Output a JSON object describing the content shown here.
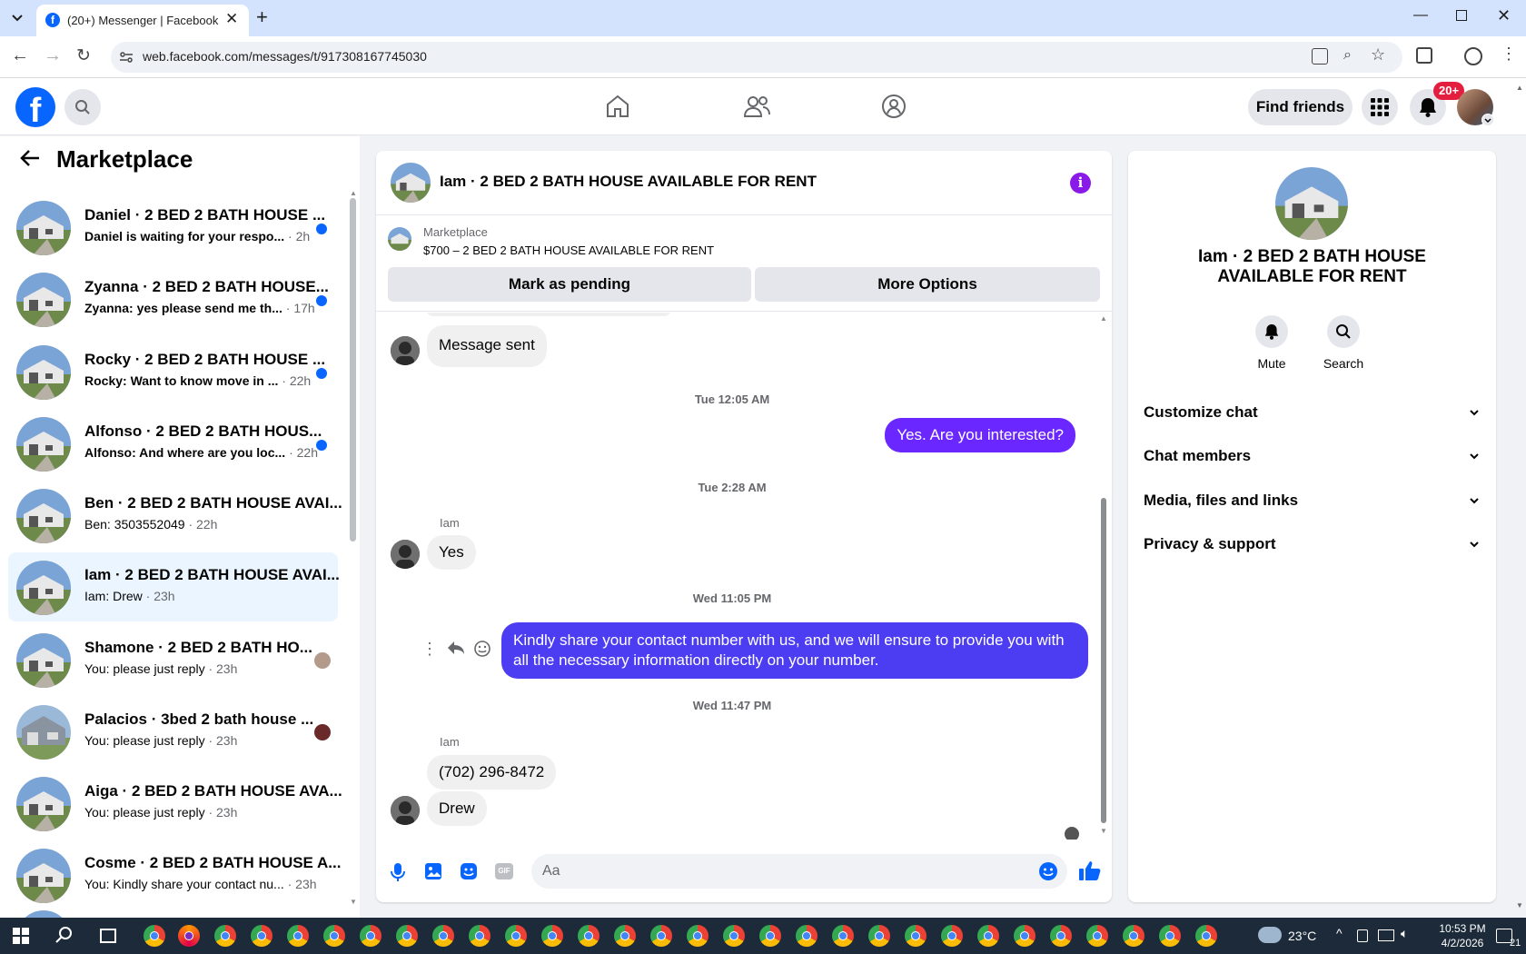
{
  "browser": {
    "tab_title": "(20+) Messenger | Facebook",
    "url": "web.facebook.com/messages/t/917308167745030"
  },
  "header": {
    "find_friends": "Find friends",
    "notif_badge": "20+"
  },
  "sidebar": {
    "title": "Marketplace",
    "conversations": [
      {
        "title": "Daniel · 2 BED 2 BATH HOUSE ...",
        "preview": "Daniel is waiting for your respo...",
        "time": "· 2h",
        "unread": true
      },
      {
        "title": "Zyanna · 2 BED 2 BATH HOUSE...",
        "preview": "Zyanna: yes please send me th...",
        "time": "· 17h",
        "unread": true
      },
      {
        "title": "Rocky · 2 BED 2 BATH HOUSE ...",
        "preview": "Rocky: Want to know move in ...",
        "time": "· 22h",
        "unread": true
      },
      {
        "title": "Alfonso · 2 BED 2 BATH HOUS...",
        "preview": "Alfonso: And where are you loc...",
        "time": "· 22h",
        "unread": true
      },
      {
        "title": "Ben · 2 BED 2 BATH HOUSE AVAI...",
        "preview": "Ben: 3503552049",
        "time": "· 22h",
        "unread": false
      },
      {
        "title": "Iam · 2 BED 2 BATH HOUSE AVAI...",
        "preview": "Iam: Drew",
        "time": "· 23h",
        "unread": false
      },
      {
        "title": "Shamone · 2 BED 2 BATH HO...",
        "preview": "You: please just reply",
        "time": "· 23h",
        "unread": false
      },
      {
        "title": "Palacios · 3bed 2 bath house ...",
        "preview": "You: please just reply",
        "time": "· 23h",
        "unread": false
      },
      {
        "title": "Aiga · 2 BED 2 BATH HOUSE AVA...",
        "preview": "You: please just reply",
        "time": "· 23h",
        "unread": false
      },
      {
        "title": "Cosme · 2 BED 2 BATH HOUSE A...",
        "preview": "You: Kindly share your contact nu...",
        "time": "· 23h",
        "unread": false
      }
    ]
  },
  "chat": {
    "title": "Iam · 2 BED 2 BATH HOUSE AVAILABLE FOR RENT",
    "listing_source": "Marketplace",
    "listing_title": "$700 – 2 BED 2 BATH HOUSE AVAILABLE FOR RENT",
    "mark_pending": "Mark as pending",
    "more_options": "More Options",
    "msg1": "Message sent",
    "ts1": "Tue 12:05 AM",
    "msg2": "Yes. Are you interested?",
    "ts2": "Tue 2:28 AM",
    "sender1": "Iam",
    "msg3": "Yes",
    "ts3": "Wed 11:05 PM",
    "msg4": "Kindly share your contact number with us, and we will ensure to provide you with all the necessary information directly on your number.",
    "ts4": "Wed 11:47 PM",
    "sender2": "Iam",
    "msg5": "(702) 296-8472",
    "msg6": "Drew",
    "input_placeholder": "Aa"
  },
  "right": {
    "name": "Iam · 2 BED 2 BATH HOUSE AVAILABLE FOR RENT",
    "mute": "Mute",
    "search": "Search",
    "sections": [
      "Customize chat",
      "Chat members",
      "Media, files and links",
      "Privacy & support"
    ]
  },
  "taskbar": {
    "temp": "23°C",
    "time": "10:53 PM",
    "date": "4/2/2026",
    "notif": "21"
  },
  "colors": {
    "accent": "#0866ff",
    "outgoing": "#6a27ff"
  }
}
